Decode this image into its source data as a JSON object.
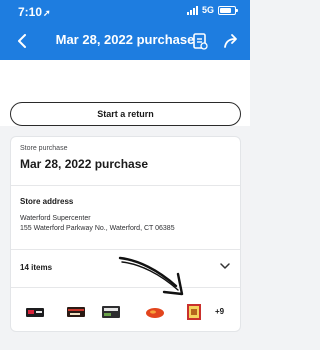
{
  "status_bar": {
    "time": "7:10",
    "network": "5G"
  },
  "nav": {
    "title": "Mar 28, 2022 purchase"
  },
  "actions": {
    "start_return": "Start a return"
  },
  "purchase": {
    "type_label": "Store purchase",
    "date_title": "Mar 28, 2022 purchase",
    "address_heading": "Store address",
    "store_name": "Waterford Supercenter",
    "store_address": "155 Waterford Parkway No., Waterford, CT 06385"
  },
  "items": {
    "count_label": "14 items",
    "more_label": "+9",
    "thumbnails": [
      "black-snack-box-icon",
      "candy-box-icon",
      "cereal-pack-icon",
      "red-snack-bag-icon",
      "gift-box-icon"
    ]
  },
  "colors": {
    "brand_blue": "#1e7de0",
    "annotation": "#111111"
  }
}
